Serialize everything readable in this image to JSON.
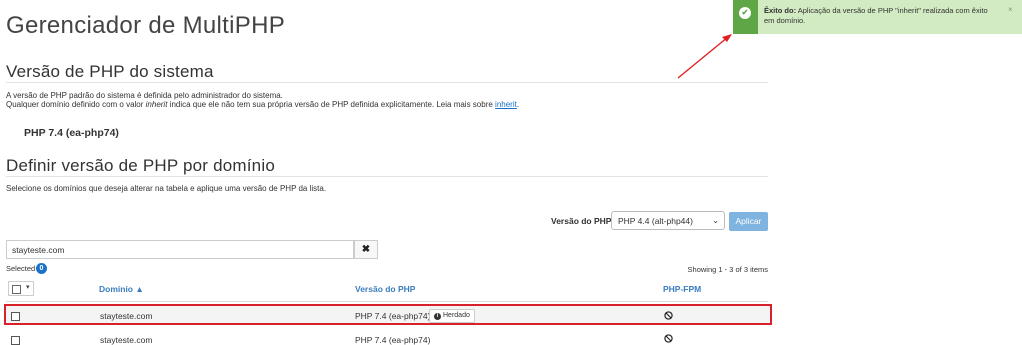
{
  "page": {
    "title": "Gerenciador de MultiPHP"
  },
  "system_section": {
    "heading": "Versão de PHP do sistema",
    "line1": "A versão de PHP padrão do sistema é definida pelo administrador do sistema.",
    "line2_prefix": "Qualquer domínio definido com o valor ",
    "line2_em": "inherit",
    "line2_middle": " indica que ele não tem sua própria versão de PHP definida explicitamente. Leia mais sobre ",
    "line2_link": "inherit",
    "line2_suffix": ".",
    "current_version": "PHP 7.4 (ea-php74)"
  },
  "domain_section": {
    "heading": "Definir versão de PHP por domínio",
    "description": "Selecione os domínios que deseja alterar na tabela e aplique uma versão de PHP da lista.",
    "version_label": "Versão do PHP",
    "selected_version": "PHP 4.4 (alt-php44)",
    "apply_label": "Aplicar",
    "search_value": "stayteste.com",
    "search_clear": "✖",
    "selected_label": "Selected",
    "selected_count": "0",
    "showing_prefix": "Showing ",
    "showing_range": "1 - 3 of 3 items"
  },
  "table": {
    "columns": [
      "Domínio ▲",
      "Versão do PHP",
      "PHP-FPM"
    ],
    "rows": [
      {
        "domain": "stayteste.com",
        "php": "PHP 7.4 (ea-php74)",
        "badge": "Herdado",
        "fpm": "disabled-icon"
      },
      {
        "domain": "stayteste.com",
        "php": "PHP 7.4 (ea-php74)",
        "badge": "",
        "fpm": "disabled-icon"
      }
    ]
  },
  "toast": {
    "title": "Êxito do:",
    "message": " Aplicação da versão de PHP \"inherit\" realizada com êxito em domínio.",
    "close": "×"
  },
  "colors": {
    "toast_accent": "#5ea646",
    "link": "#1a73c6",
    "highlight": "#d8212b",
    "arrow": "#e02020"
  }
}
